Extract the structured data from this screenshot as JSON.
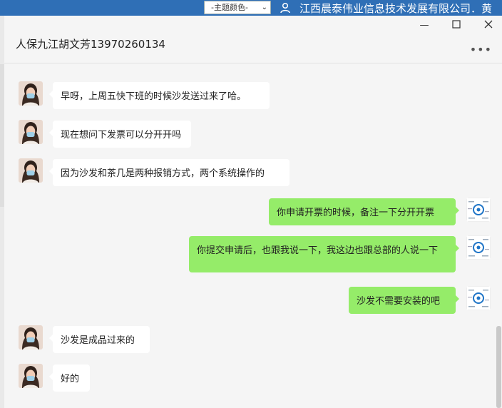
{
  "topbar": {
    "theme_select": "-主题颜色-",
    "company": "江西晨泰伟业信息技术发展有限公司．黄"
  },
  "chat": {
    "title": "人保九江胡文芳13970260134",
    "messages": [
      {
        "side": "in",
        "text": "早呀，上周五快下班的时候沙发送过来了哈。"
      },
      {
        "side": "in",
        "text": "现在想问下发票可以分开开吗"
      },
      {
        "side": "in",
        "text": "因为沙发和茶几是两种报销方式，两个系统操作的"
      },
      {
        "side": "out",
        "text": "你申请开票的时候，备注一下分开开票"
      },
      {
        "side": "out",
        "text": "你提交申请后，也跟我说一下，我这边也跟总部的人说一下"
      },
      {
        "side": "out",
        "text": "沙发不需要安装的吧"
      },
      {
        "side": "in",
        "text": "沙发是成品过来的"
      },
      {
        "side": "in",
        "text": "好的"
      }
    ]
  },
  "icons": {
    "user": "user-icon",
    "minimize": "minimize-icon",
    "maximize": "maximize-icon",
    "close": "close-icon",
    "more": "more-icon",
    "dropdown": "chevron-down-icon"
  },
  "colors": {
    "topbar": "#2f6fb6",
    "bubble_out": "#95ec69",
    "bubble_in": "#ffffff"
  }
}
